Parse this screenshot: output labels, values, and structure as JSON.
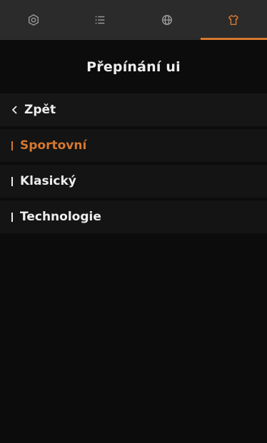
{
  "tabs": [
    {
      "icon": "settings-icon",
      "active": false
    },
    {
      "icon": "list-icon",
      "active": false
    },
    {
      "icon": "globe-icon",
      "active": false
    },
    {
      "icon": "shirt-icon",
      "active": true
    }
  ],
  "header": {
    "title": "Přepínání ui"
  },
  "menu": {
    "back_label": "Zpět",
    "items": [
      {
        "label": "Sportovní",
        "active": true
      },
      {
        "label": "Klasický",
        "active": false
      },
      {
        "label": "Technologie",
        "active": false
      }
    ]
  },
  "colors": {
    "accent": "#d7782e",
    "background": "#0c0c0c",
    "tabbar": "#2b2b2b",
    "text": "#ededed"
  }
}
